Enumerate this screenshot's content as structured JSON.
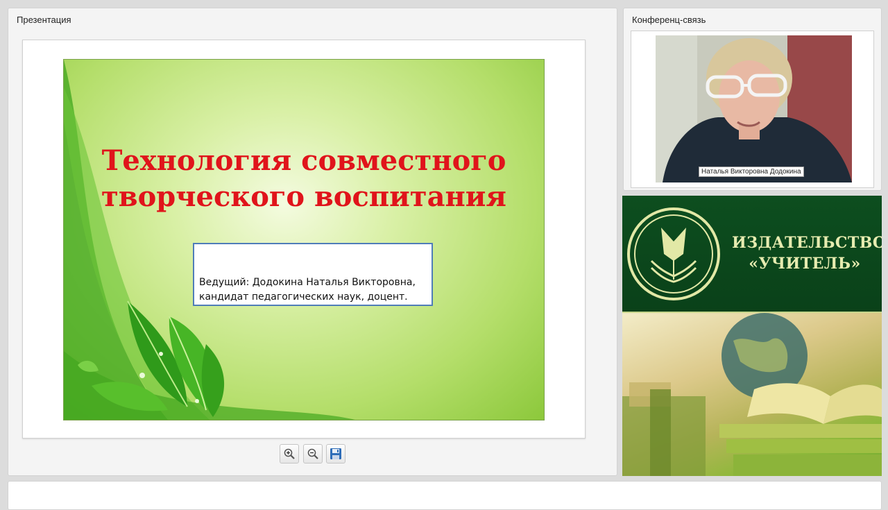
{
  "presentation": {
    "panel_title": "Презентация",
    "slide": {
      "title_line1": "Технология совместного",
      "title_line2": "творческого воспитания",
      "host_line1": "Ведущий: Додокина Наталья Викторовна,",
      "host_line2": "кандидат педагогических наук, доцент."
    },
    "toolbar": {
      "zoom_in_icon": "zoom-in-icon",
      "zoom_out_icon": "zoom-out-icon",
      "save_icon": "save-icon"
    }
  },
  "conference": {
    "panel_title": "Конференц-связь",
    "participant_name": "Наталья Викторовна Додокина"
  },
  "banner": {
    "publisher_line1": "ИЗДАТЕЛЬСТВО",
    "publisher_line2": "«УЧИТЕЛЬ»"
  },
  "colors": {
    "slide_title": "#e0141b",
    "banner_green": "#0d4e1f",
    "banner_text": "#e7ecb0",
    "slide_green": "#8cc83b"
  }
}
